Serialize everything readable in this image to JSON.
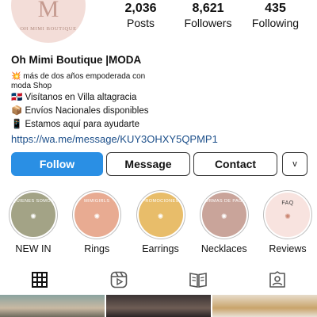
{
  "profile": {
    "avatar_monogram": "M",
    "avatar_brand": "OH MIMI BOUTIQUE",
    "name": "Oh Mimi Boutique |MODA",
    "bio_line1": "💥 más de dos años empoderada con moda Shop",
    "bio_line2": "🇩🇴 Visítanos en Villa altagracia",
    "bio_line3": "📦 Envíos Nacionales disponibles",
    "bio_line4": "📱 Estamos aquí para ayudarte",
    "link": "https://wa.me/message/KUY3OHXY5QPMP1"
  },
  "stats": [
    {
      "value": "2,036",
      "label": "Posts"
    },
    {
      "value": "8,621",
      "label": "Followers"
    },
    {
      "value": "435",
      "label": "Following"
    }
  ],
  "buttons": {
    "follow": "Follow",
    "message": "Message",
    "contact": "Contact",
    "more": "v"
  },
  "highlights": [
    {
      "label": "NEW IN",
      "cover_text": "QUIENES SOMOS",
      "color": "#a3a386"
    },
    {
      "label": "Rings",
      "cover_text": "MIMIGIRLS",
      "color": "#e8ab92"
    },
    {
      "label": "Earrings",
      "cover_text": "PROMOCIONES",
      "color": "#e8bd6a"
    },
    {
      "label": "Necklaces",
      "cover_text": "FORMAS DE PAGO",
      "color": "#c9a49a"
    },
    {
      "label": "Reviews",
      "cover_text": "FAQ",
      "color": "#f8e3df"
    }
  ],
  "tabs": [
    {
      "icon": "grid-icon"
    },
    {
      "icon": "reels-icon"
    },
    {
      "icon": "guide-icon"
    },
    {
      "icon": "tagged-icon"
    }
  ],
  "colors": {
    "follow_blue": "#2a8fe4",
    "link_blue": "#1c4f8a"
  }
}
